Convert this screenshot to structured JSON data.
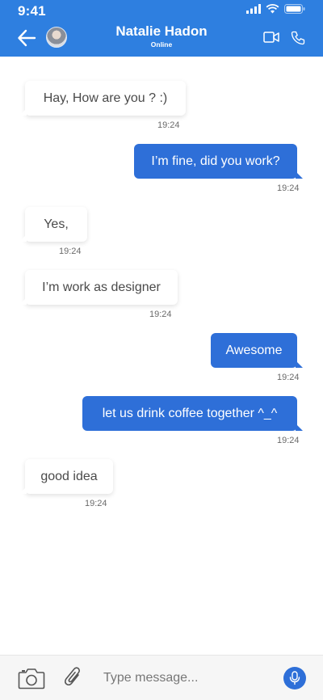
{
  "status_bar": {
    "time": "9:41"
  },
  "header": {
    "contact_name": "Natalie Hadon",
    "contact_status": "Online",
    "accent_color": "#2e7fe0"
  },
  "messages": [
    {
      "direction": "in",
      "text": "Hay, How are you ? :)",
      "time": "19:24"
    },
    {
      "direction": "out",
      "text": "I’m fine, did you work?",
      "time": "19:24"
    },
    {
      "direction": "in",
      "text": "Yes,",
      "time": "19:24"
    },
    {
      "direction": "in",
      "text": "I’m work as designer",
      "time": "19:24"
    },
    {
      "direction": "out",
      "text": "Awesome",
      "time": "19:24"
    },
    {
      "direction": "out",
      "text": "let us drink coffee together ^_^",
      "time": "19:24"
    },
    {
      "direction": "in",
      "text": "good idea",
      "time": "19:24"
    }
  ],
  "composer": {
    "placeholder": "Type message...",
    "icons": [
      "camera-icon",
      "paperclip-icon",
      "microphone-icon"
    ]
  },
  "colors": {
    "outgoing_bubble": "#2e6fd8",
    "incoming_bubble": "#ffffff"
  }
}
